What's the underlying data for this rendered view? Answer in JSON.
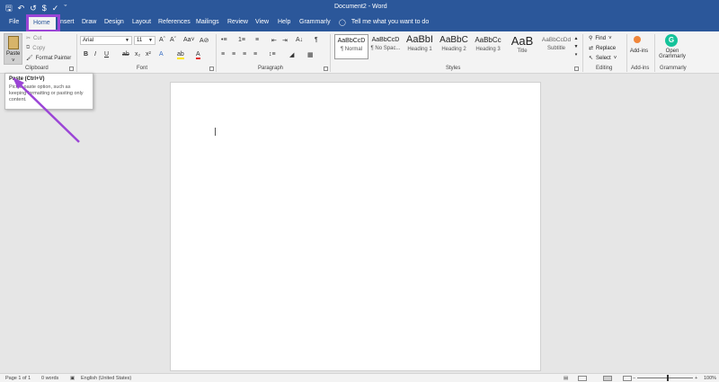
{
  "title_bar": {
    "doc_title": "Document2  -  Word",
    "qat": [
      "save-icon",
      "undo-icon",
      "redo-icon",
      "autosave-icon",
      "spelling-icon",
      "customize-icon"
    ]
  },
  "tabs": [
    "File",
    "Home",
    "Insert",
    "Draw",
    "Design",
    "Layout",
    "References",
    "Mailings",
    "Review",
    "View",
    "Help",
    "Grammarly"
  ],
  "active_tab": "Home",
  "tell_me": "Tell me what you want to do",
  "clipboard": {
    "paste_label": "Paste",
    "cut_label": "Cut",
    "copy_label": "Copy",
    "format_painter_label": "Format Painter",
    "group_label": "Clipboard"
  },
  "font": {
    "font_name": "Arial",
    "font_size": "11",
    "group_label": "Font"
  },
  "paragraph": {
    "group_label": "Paragraph"
  },
  "styles": {
    "group_label": "Styles",
    "items": [
      {
        "sample": "AaBbCcD",
        "name": "¶ Normal"
      },
      {
        "sample": "AaBbCcD",
        "name": "¶ No Spac..."
      },
      {
        "sample": "AaBbI",
        "name": "Heading 1"
      },
      {
        "sample": "AaBbC",
        "name": "Heading 2"
      },
      {
        "sample": "AaBbCc",
        "name": "Heading 3"
      },
      {
        "sample": "AaB",
        "name": "Title"
      },
      {
        "sample": "AaBbCcDd",
        "name": "Subtitle"
      }
    ],
    "selected": "¶ Normal"
  },
  "editing": {
    "find_label": "Find",
    "replace_label": "Replace",
    "select_label": "Select",
    "group_label": "Editing"
  },
  "addins": {
    "button_label": "Add-ins",
    "group_label": "Add-ins"
  },
  "grammarly": {
    "button_label": "Open Grammarly",
    "group_label": "Grammarly"
  },
  "tooltip": {
    "title": "Paste (Ctrl+V)",
    "body": "Pick a paste option, such as keeping formatting or pasting only content."
  },
  "status_bar": {
    "page": "Page 1 of 1",
    "words": "0 words",
    "language": "English (United States)",
    "zoom": "100%"
  },
  "colors": {
    "title_bar": "#2b579a",
    "highlight": "#9b45d6",
    "grammarly": "#15c39a",
    "addins": "#f0863a"
  }
}
